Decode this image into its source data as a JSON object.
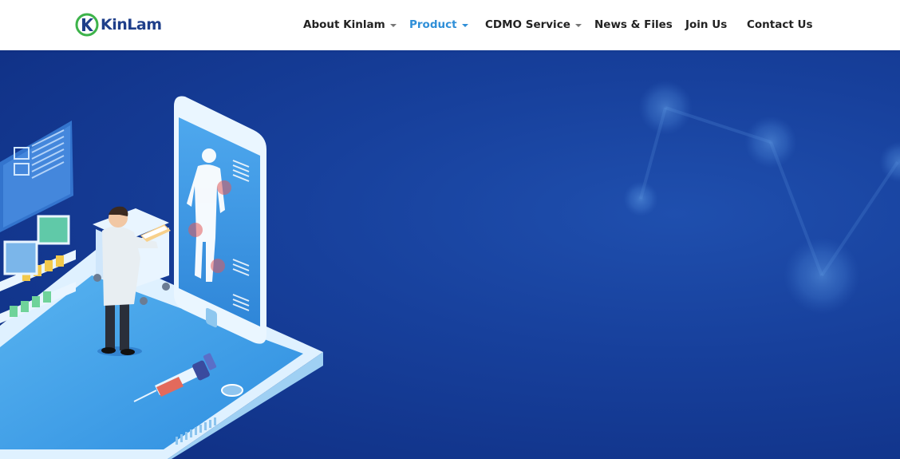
{
  "brand": {
    "logo_text": "KinLam",
    "logo_icon": "kinlam-k-logo-icon",
    "colors": {
      "primary": "#1f3f8a",
      "accent_green": "#3db34a"
    }
  },
  "nav": {
    "items": [
      {
        "label": "About Kinlam",
        "has_dropdown": true,
        "active": false
      },
      {
        "label": "Product",
        "has_dropdown": true,
        "active": true
      },
      {
        "label": "CDMO Service",
        "has_dropdown": true,
        "active": false
      },
      {
        "label": "News & Files",
        "has_dropdown": false,
        "active": false
      },
      {
        "label": "Join Us",
        "has_dropdown": false,
        "active": false
      },
      {
        "label": "Contact Us",
        "has_dropdown": false,
        "active": false
      }
    ],
    "active_color": "#2f8fd8",
    "text_color": "#222222"
  },
  "hero": {
    "illustration": "medical-technology-isometric-illustration",
    "background_color": "#17409c"
  }
}
